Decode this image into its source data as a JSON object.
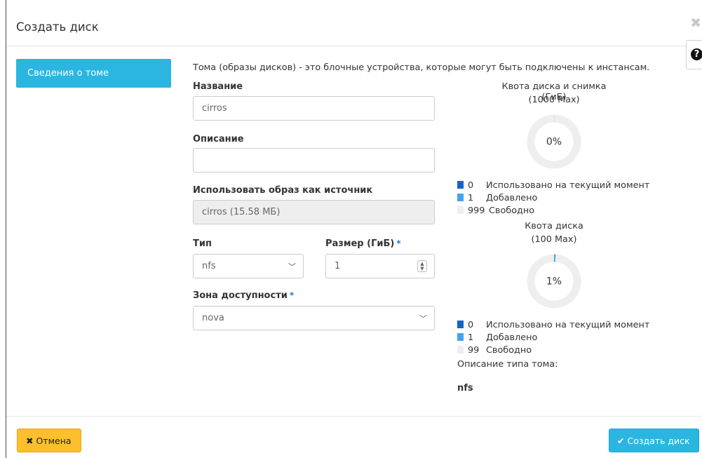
{
  "modal": {
    "title": "Создать диск",
    "close_icon": "close-icon",
    "help_icon": "question-circle-icon",
    "help_glyph": "?"
  },
  "side_tab": {
    "label": "Сведения о томе"
  },
  "intro": "Тома (образы дисков) - это блочные устройства, которые могут быть подключены к инстансам.",
  "form": {
    "name_label": "Название",
    "name_value": "cirros",
    "description_label": "Описание",
    "description_value": "",
    "source_label": "Использовать образ как источник",
    "source_value": "cirros (15.58 МБ)",
    "type_label": "Тип",
    "type_value": "nfs",
    "size_label": "Размер (ГиБ)",
    "size_value": "1",
    "az_label": "Зона доступности",
    "az_value": "nova",
    "required_mark": "*"
  },
  "quota_total": {
    "title": "Квота диска и снимка (ГиБ)",
    "max": "(1000 Max)",
    "percent_label": "0%",
    "used_fraction": 0.001,
    "legend": [
      {
        "value": "0",
        "label": "Использовано на текущий момент",
        "color": "#1565c0"
      },
      {
        "value": "1",
        "label": "Добавлено",
        "color": "#42a5f5"
      },
      {
        "value": "999",
        "label": "Свободно",
        "color": "#eeeeee"
      }
    ]
  },
  "quota_disk": {
    "title": "Квота диска",
    "max": "(100 Max)",
    "percent_label": "1%",
    "used_fraction": 0.01,
    "legend": [
      {
        "value": "0",
        "label": "Использовано на текущий момент",
        "color": "#1565c0"
      },
      {
        "value": "1",
        "label": "Добавлено",
        "color": "#42a5f5"
      },
      {
        "value": "99",
        "label": "Свободно",
        "color": "#eeeeee"
      }
    ]
  },
  "type_description": {
    "label": "Описание типа тома:",
    "value": "nfs"
  },
  "footer": {
    "cancel_label": "Отмена",
    "cancel_icon": "times-icon",
    "create_label": "Создать диск",
    "create_icon": "check-icon"
  },
  "colors": {
    "accent": "#2ab6e1",
    "warning": "#fdbf2d"
  }
}
